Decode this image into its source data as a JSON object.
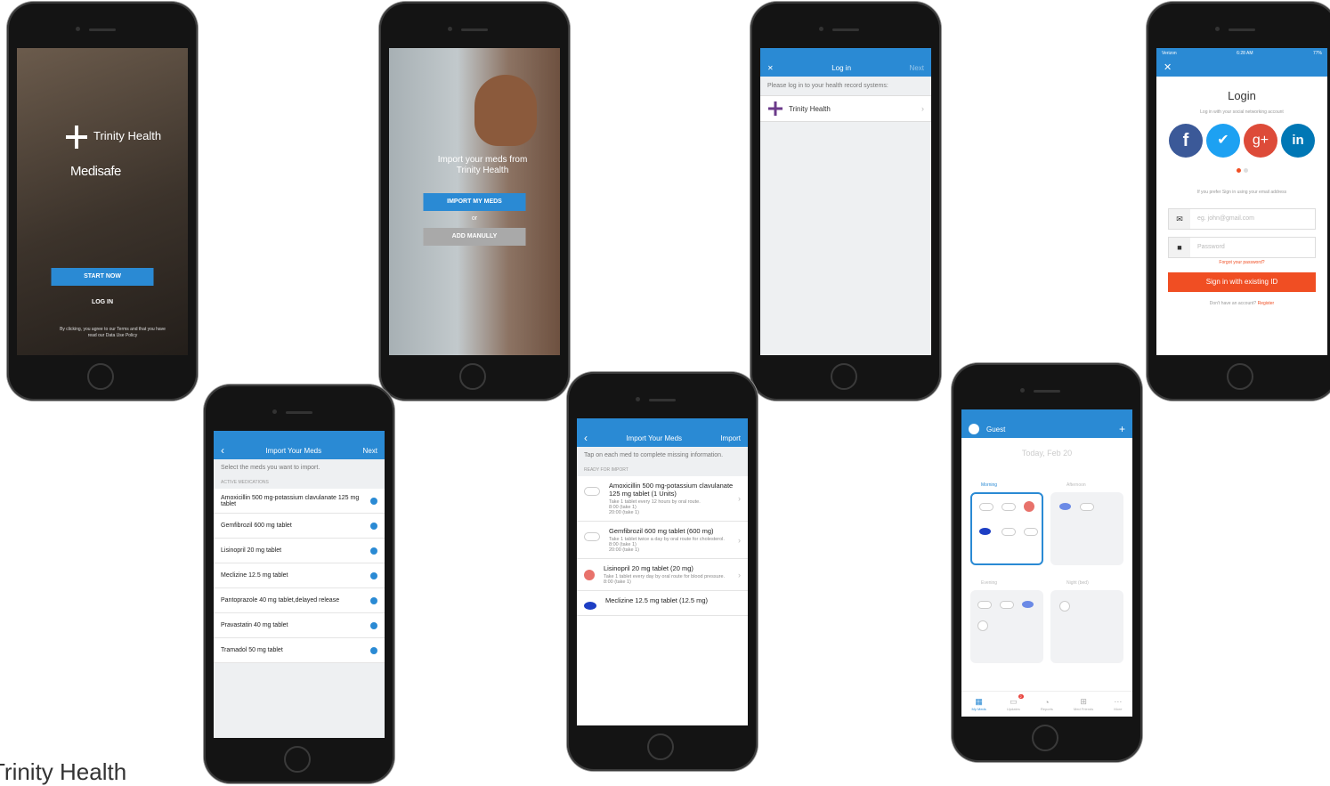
{
  "footer_brand": "Trinity Health",
  "colors": {
    "blue": "#2a8ad4",
    "orange": "#f04e23",
    "facebook": "#3b5998",
    "twitter": "#1da1f2",
    "google": "#dd4b39",
    "linkedin": "#0077b5"
  },
  "screen1": {
    "brand": "Trinity Health",
    "app": "Medisafe",
    "start": "START NOW",
    "login": "LOG IN",
    "legal": "By clicking, you agree to our Terms and that you have read our Data Use Policy"
  },
  "screen2": {
    "headline": "Import your meds from Trinity Health",
    "import": "IMPORT MY MEDS",
    "or": "or",
    "manual": "ADD MANULLY"
  },
  "screen3": {
    "close": "✕",
    "title": "Log in",
    "next": "Next",
    "hint": "Please log in to your health record systems:",
    "provider": "Trinity Health"
  },
  "screen4": {
    "carrier": "Verizon",
    "time": "6:28 AM",
    "battery": "77%",
    "title": "Login",
    "subtitle": "Log in with your social networking account",
    "email_hint": "If you prefer Sign in using your email address",
    "email_ph": "eg. john@gmail.com",
    "password_ph": "Password",
    "forgot": "Forgot your password?",
    "signin": "Sign in with existing ID",
    "noaccount": "Don't have an account?",
    "register": "Register"
  },
  "screen5": {
    "back": "‹",
    "title": "Import Your Meds",
    "next": "Next",
    "hint": "Select the meds you want to import.",
    "section": "Active medications",
    "meds": [
      "Amoxicillin 500 mg-potassium clavulanate 125 mg tablet",
      "Gemfibrozil 600 mg tablet",
      "Lisinopril 20 mg tablet",
      "Meclizine 12.5 mg tablet",
      "Pantoprazole 40 mg tablet,delayed release",
      "Pravastatin 40 mg tablet",
      "Tramadol 50 mg tablet"
    ]
  },
  "screen6": {
    "back": "‹",
    "title": "Import Your Meds",
    "action": "Import",
    "hint": "Tap on each med to complete missing information.",
    "section": "Ready for import",
    "meds": [
      {
        "name": "Amoxicillin 500 mg-potassium clavulanate 125 mg tablet (1 Units)",
        "detail": "Take 1 tablet every 12 hours by oral route.\n8:00 (take 1)\n20:00 (take 1)"
      },
      {
        "name": "Gemfibrozil 600 mg tablet (600 mg)",
        "detail": "Take 1 tablet twice a day by oral route for cholesterol.\n8:00 (take 1)\n20:00 (take 1)"
      },
      {
        "name": "Lisinopril 20 mg tablet (20 mg)",
        "detail": "Take 1 tablet every day by oral route for blood pressure.\n8:00 (take 1)"
      },
      {
        "name": "Meclizine 12.5 mg tablet (12.5 mg)",
        "detail": ""
      }
    ]
  },
  "screen7": {
    "user": "Guest",
    "plus": "+",
    "date": "Today, Feb 20",
    "morning": "Morning",
    "afternoon": "Afternoon",
    "evening": "Evening",
    "night": "Night (bed)",
    "badge": "2",
    "tabs": [
      "My Meds",
      "Updates",
      "Reports",
      "Med Friends",
      "More"
    ]
  }
}
